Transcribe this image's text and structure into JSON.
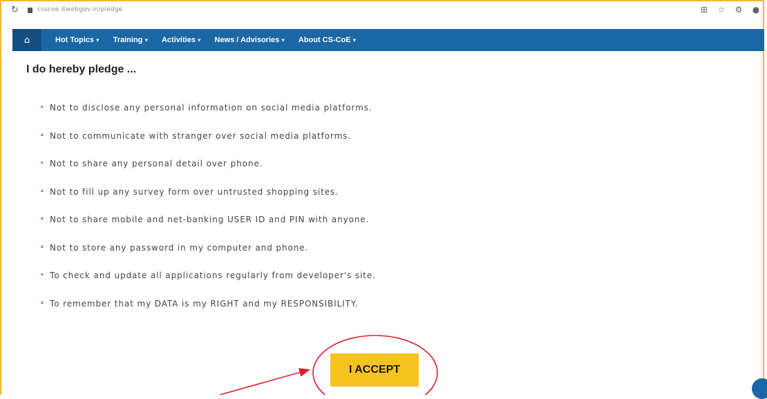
{
  "browser": {
    "url": "csscoe.itwebgov.in/pledge",
    "reload_icon": "reload-icon",
    "lock_icon": "lock-icon",
    "toolbar_icons": [
      "install-icon",
      "star-icon",
      "extensions-icon",
      "profile-icon"
    ]
  },
  "nav": {
    "home_icon": "home-icon",
    "items": [
      {
        "label": "Hot Topics"
      },
      {
        "label": "Training"
      },
      {
        "label": "Activities"
      },
      {
        "label": "News / Advisories"
      },
      {
        "label": "About CS-CoE"
      }
    ],
    "caret": "▾"
  },
  "content": {
    "heading": "I do hereby pledge ...",
    "bullet": "•",
    "pledges": [
      "Not to disclose any personal information on social media platforms.",
      "Not to communicate with stranger over social media platforms.",
      "Not to share any personal detail over phone.",
      "Not to fill up any survey form over untrusted shopping sites.",
      "Not to share mobile and net-banking USER ID and PIN with anyone.",
      "Not to store any password in my computer and phone.",
      "To check and update all applications regularly from developer's site.",
      "To remember that my DATA is my RIGHT and my RESPONSIBILITY."
    ],
    "accept_label": "I ACCEPT"
  },
  "colors": {
    "nav_bg": "#1b67a6",
    "accept_bg": "#f5c320",
    "annotation": "#d9202a",
    "frame": "#f2b830"
  }
}
